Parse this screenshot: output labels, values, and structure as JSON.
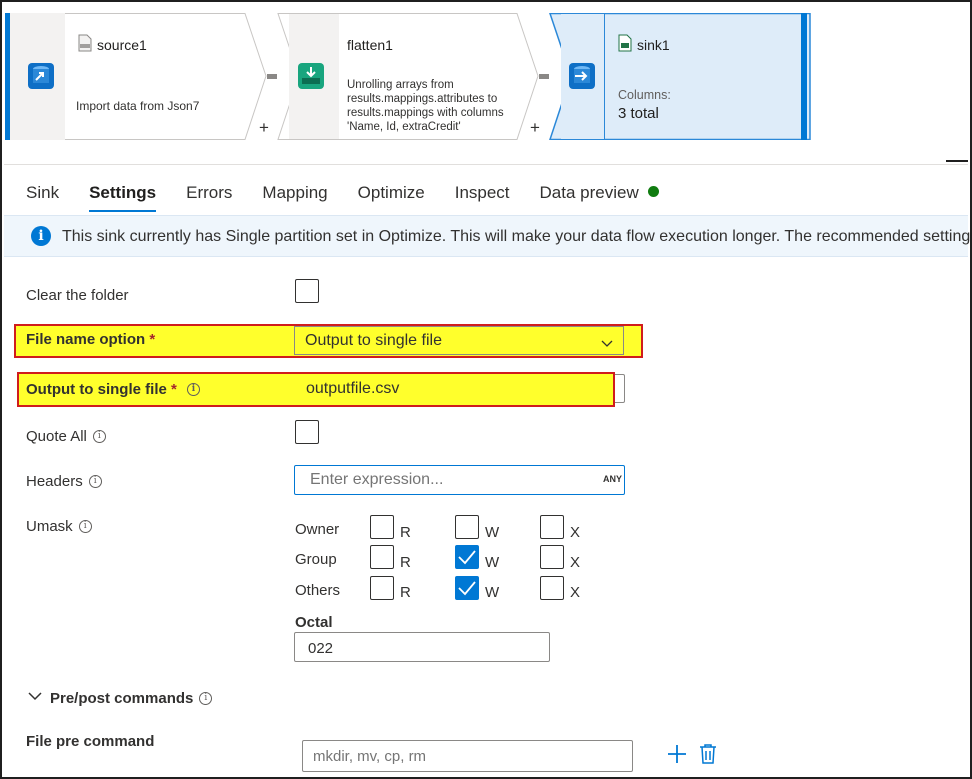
{
  "pipeline": {
    "source": {
      "title": "source1",
      "description": "Import data from Json7"
    },
    "flatten": {
      "title": "flatten1",
      "description_lines": [
        "Unrolling arrays from",
        "results.mappings.attributes to",
        "results.mappings with columns",
        "'Name, Id, extraCredit'"
      ]
    },
    "sink": {
      "title": "sink1",
      "columns_label": "Columns:",
      "columns_value": "3 total"
    },
    "plus_symbol": "+"
  },
  "tabs": [
    {
      "label": "Sink",
      "active": false
    },
    {
      "label": "Settings",
      "active": true
    },
    {
      "label": "Errors",
      "active": false
    },
    {
      "label": "Mapping",
      "active": false
    },
    {
      "label": "Optimize",
      "active": false
    },
    {
      "label": "Inspect",
      "active": false
    },
    {
      "label": "Data preview",
      "active": false,
      "status_dot_color": "#107c10"
    }
  ],
  "banner": {
    "icon": "info-icon",
    "message": "This sink currently has Single partition set in Optimize. This will make your data flow execution longer. The recommended setting"
  },
  "form": {
    "clear_folder": {
      "label": "Clear the folder",
      "checked": false
    },
    "file_name_option": {
      "label": "File name option",
      "required_mark": "*",
      "value": "Output to single file"
    },
    "output_single_file": {
      "label": "Output to single file",
      "required_mark": "*",
      "value": "outputfile.csv"
    },
    "quote_all": {
      "label": "Quote All",
      "checked": false
    },
    "headers": {
      "label": "Headers",
      "placeholder": "Enter expression...",
      "badge": "ANY"
    },
    "umask": {
      "label": "Umask",
      "rows": [
        {
          "name": "Owner",
          "r": false,
          "w": false,
          "x": false
        },
        {
          "name": "Group",
          "r": false,
          "w": true,
          "x": false
        },
        {
          "name": "Others",
          "r": false,
          "w": true,
          "x": false
        }
      ],
      "letters": {
        "r": "R",
        "w": "W",
        "x": "X"
      },
      "octal_label": "Octal",
      "octal_value": "022"
    },
    "pre_post": {
      "label": "Pre/post commands"
    },
    "file_pre_command": {
      "label": "File pre command",
      "placeholder": "mkdir, mv, cp, rm"
    }
  },
  "colors": {
    "accent": "#0078d4",
    "highlight": "#ffff2c",
    "highlight_border": "#d01c1c",
    "banner_bg": "#eff6fc",
    "success": "#107c10"
  }
}
